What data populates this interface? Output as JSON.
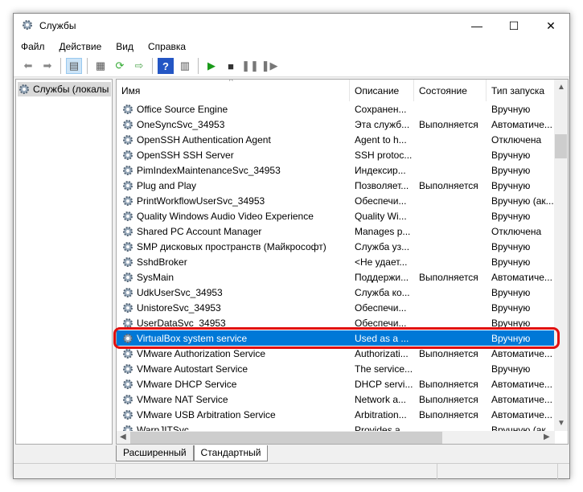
{
  "window": {
    "title": "Службы",
    "minimize": "—",
    "maximize": "☐",
    "close": "✕"
  },
  "menu": [
    "Файл",
    "Действие",
    "Вид",
    "Справка"
  ],
  "toolbar": [
    "back-icon",
    "forward-icon",
    "show-hide-tree-icon",
    "properties-icon",
    "refresh-icon",
    "export-list-icon",
    "help-icon",
    "console-view-icon",
    "start-service-icon",
    "stop-service-icon",
    "pause-service-icon",
    "resume-service-icon"
  ],
  "tree": {
    "root": "Службы (локалы"
  },
  "columns": [
    "Имя",
    "Описание",
    "Состояние",
    "Тип запуска"
  ],
  "rows": [
    {
      "name": "Office  Source Engine",
      "desc": "Сохранен...",
      "state": "",
      "type": "Вручную"
    },
    {
      "name": "OneSyncSvc_34953",
      "desc": "Эта служб...",
      "state": "Выполняется",
      "type": "Автоматиче..."
    },
    {
      "name": "OpenSSH Authentication Agent",
      "desc": "Agent to h...",
      "state": "",
      "type": "Отключена"
    },
    {
      "name": "OpenSSH SSH Server",
      "desc": "SSH protoc...",
      "state": "",
      "type": "Вручную"
    },
    {
      "name": "PimIndexMaintenanceSvc_34953",
      "desc": "Индексир...",
      "state": "",
      "type": "Вручную"
    },
    {
      "name": "Plug and Play",
      "desc": "Позволяет...",
      "state": "Выполняется",
      "type": "Вручную"
    },
    {
      "name": "PrintWorkflowUserSvc_34953",
      "desc": "Обеспечи...",
      "state": "",
      "type": "Вручную (ак..."
    },
    {
      "name": "Quality Windows Audio Video Experience",
      "desc": "Quality Wi...",
      "state": "",
      "type": "Вручную"
    },
    {
      "name": "Shared PC Account Manager",
      "desc": "Manages p...",
      "state": "",
      "type": "Отключена"
    },
    {
      "name": "SMP дисковых пространств (Майкрософт)",
      "desc": "Служба уз...",
      "state": "",
      "type": "Вручную"
    },
    {
      "name": "SshdBroker",
      "desc": "<Не удает...",
      "state": "",
      "type": "Вручную"
    },
    {
      "name": "SysMain",
      "desc": "Поддержи...",
      "state": "Выполняется",
      "type": "Автоматиче..."
    },
    {
      "name": "UdkUserSvc_34953",
      "desc": "Служба ко...",
      "state": "",
      "type": "Вручную"
    },
    {
      "name": "UnistoreSvc_34953",
      "desc": "Обеспечи...",
      "state": "",
      "type": "Вручную"
    },
    {
      "name": "UserDataSvc_34953",
      "desc": "Обеспечи...",
      "state": "",
      "type": "Вручную"
    },
    {
      "name": "VirtualBox system service",
      "desc": "Used as a ...",
      "state": "",
      "type": "Вручную",
      "selected": true
    },
    {
      "name": "VMware Authorization Service",
      "desc": "Authorizati...",
      "state": "Выполняется",
      "type": "Автоматиче..."
    },
    {
      "name": "VMware Autostart Service",
      "desc": "The service...",
      "state": "",
      "type": "Вручную"
    },
    {
      "name": "VMware DHCP Service",
      "desc": "DHCP servi...",
      "state": "Выполняется",
      "type": "Автоматиче..."
    },
    {
      "name": "VMware NAT Service",
      "desc": "Network a...",
      "state": "Выполняется",
      "type": "Автоматиче..."
    },
    {
      "name": "VMware USB Arbitration Service",
      "desc": "Arbitration...",
      "state": "Выполняется",
      "type": "Автоматиче..."
    },
    {
      "name": "WarpJITSvc",
      "desc": "Provides a...",
      "state": "",
      "type": "Вручную (ак..."
    }
  ],
  "tabs": [
    "Расширенный",
    "Стандартный"
  ],
  "colors": {
    "selection": "#0078d7",
    "highlight": "#e01010"
  }
}
